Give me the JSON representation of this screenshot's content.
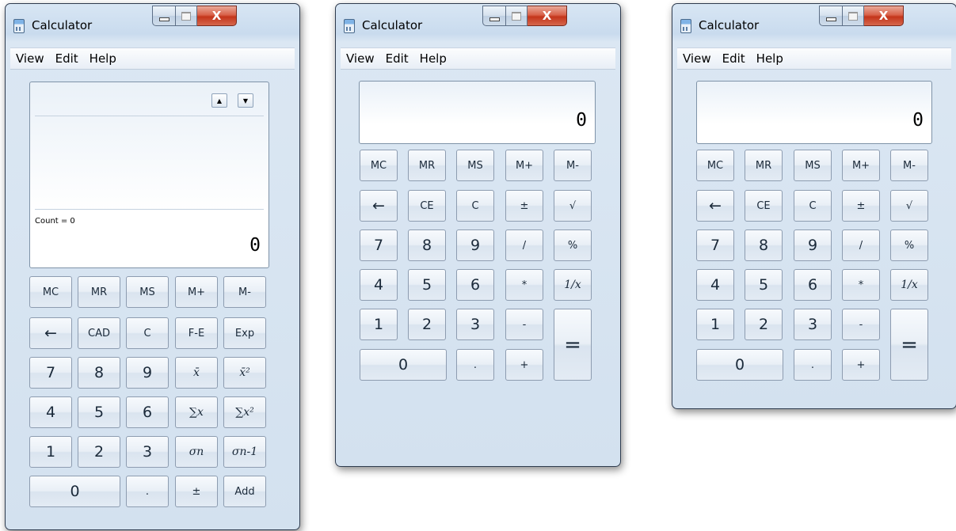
{
  "windows": [
    {
      "title": "Calculator",
      "menu": [
        "View",
        "Edit",
        "Help"
      ],
      "display_value": "0",
      "count_label": "Count = 0",
      "rows": [
        [
          "MC",
          "MR",
          "MS",
          "M+",
          "M-"
        ],
        [
          "←",
          "CAD",
          "C",
          "F-E",
          "Exp"
        ],
        [
          "7",
          "8",
          "9",
          "x̄",
          "x̄²"
        ],
        [
          "4",
          "5",
          "6",
          "∑x",
          "∑x²"
        ],
        [
          "1",
          "2",
          "3",
          "σn",
          "σn-1"
        ],
        [
          "0",
          ".",
          "±",
          "Add"
        ]
      ]
    },
    {
      "title": "Calculator",
      "menu": [
        "View",
        "Edit",
        "Help"
      ],
      "display_value": "0",
      "rows": [
        [
          "MC",
          "MR",
          "MS",
          "M+",
          "M-"
        ],
        [
          "←",
          "CE",
          "C",
          "±",
          "√"
        ],
        [
          "7",
          "8",
          "9",
          "/",
          "%"
        ],
        [
          "4",
          "5",
          "6",
          "*",
          "1/x"
        ],
        [
          "1",
          "2",
          "3",
          "-",
          "="
        ],
        [
          "0",
          ".",
          "+"
        ]
      ]
    },
    {
      "title": "Calculator",
      "menu": [
        "View",
        "Edit",
        "Help"
      ],
      "display_value": "0",
      "rows": [
        [
          "MC",
          "MR",
          "MS",
          "M+",
          "M-"
        ],
        [
          "←",
          "CE",
          "C",
          "±",
          "√"
        ],
        [
          "7",
          "8",
          "9",
          "/",
          "%"
        ],
        [
          "4",
          "5",
          "6",
          "*",
          "1/x"
        ],
        [
          "1",
          "2",
          "3",
          "-",
          "="
        ],
        [
          "0",
          ".",
          "+"
        ]
      ]
    }
  ],
  "icons": {
    "minimize": "minimize-icon",
    "maximize": "maximize-icon",
    "close": "close-icon",
    "app": "calculator-icon",
    "history_up": "arrow-up-icon",
    "history_down": "arrow-down-icon"
  },
  "colors": {
    "close_button": "#c4351b",
    "frame": "#c9dbee",
    "button_face": "#e9eff6"
  }
}
